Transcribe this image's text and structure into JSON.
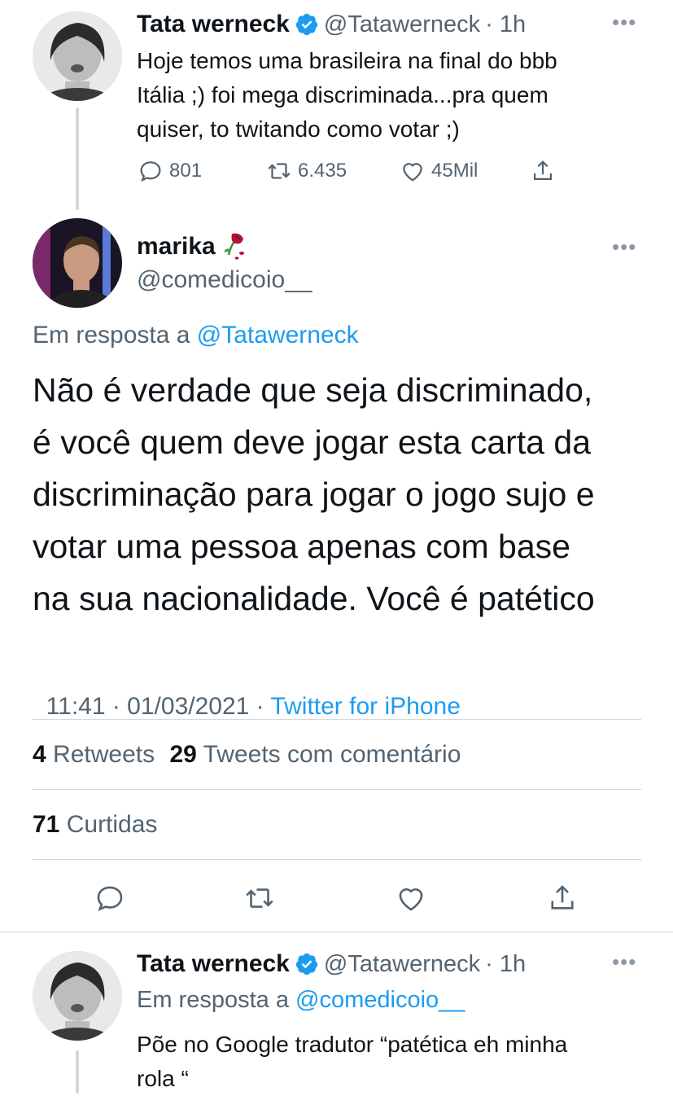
{
  "tweet1": {
    "name": "Tata werneck",
    "handle": "@Tatawerneck",
    "time": "· 1h",
    "text_lines": [
      "Hoje temos uma brasileira na final do bbb",
      "Itália ;) foi mega discriminada...pra quem",
      "quiser, to twitando como votar ;)"
    ],
    "replies": "801",
    "retweets": "6.435",
    "likes": "45Mil"
  },
  "main": {
    "name": "marika",
    "handle": "@comedicoio__",
    "reply_prefix": "Em resposta a",
    "reply_handle": "@Tatawerneck",
    "text_lines": [
      "Não é verdade que seja discriminado,",
      "é você quem deve jogar esta carta da",
      "discriminação para jogar o jogo sujo e",
      "votar uma pessoa apenas com base",
      "na sua nacionalidade.  Você é patético"
    ],
    "timestamp": "11:41 · 01/03/2021 · ",
    "source": "Twitter for iPhone",
    "retweets_count": "4",
    "retweets_label": "Retweets",
    "quotes_count": "29",
    "quotes_label": "Tweets com comentário",
    "likes_count": "71",
    "likes_label": "Curtidas"
  },
  "reply": {
    "name": "Tata werneck",
    "handle": "@Tatawerneck",
    "time": "· 1h",
    "reply_prefix": "Em resposta a",
    "reply_handle": "@comedicoio__",
    "text_lines": [
      "Põe no Google tradutor “patética eh minha",
      "rola “"
    ]
  },
  "colors": {
    "accent": "#1d9bf0",
    "verified": "#1d9bf0",
    "text": "#0f1419",
    "muted": "#536471"
  },
  "icons": [
    "reply-icon",
    "retweet-icon",
    "like-icon",
    "share-icon",
    "verified-badge-icon",
    "more-icon",
    "rose-emoji"
  ]
}
